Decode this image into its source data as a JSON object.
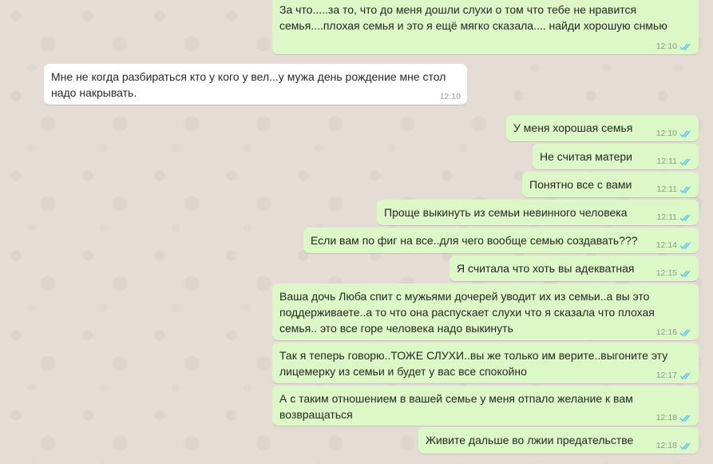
{
  "colors": {
    "background": "#e5ddd5",
    "outgoing_bubble": "#dcf8c6",
    "incoming_bubble": "#ffffff",
    "read_ticks": "#4fc3f7"
  },
  "messages": [
    {
      "dir": "out",
      "text": "За что.....за то, что до меня дошли слухи о том что тебе не нравится семья....плохая семья и это я ещё мягко сказала.... найди хорошую снмью",
      "time": "12:10",
      "status": "read-double-check-icon"
    },
    {
      "dir": "in",
      "text": "Мне не когда разбираться кто у кого у вел...у мужа день рождение мне стол надо накрывать.",
      "time": "12:10"
    },
    {
      "dir": "out",
      "text": "У меня хорошая семья",
      "time": "12:10",
      "status": "read-double-check-icon"
    },
    {
      "dir": "out",
      "text": "Не считая матери",
      "time": "12:11",
      "status": "read-double-check-icon"
    },
    {
      "dir": "out",
      "text": "Понятно все с вами",
      "time": "12:11",
      "status": "read-double-check-icon"
    },
    {
      "dir": "out",
      "text": "Проще выкинуть из семьи невинного человека",
      "time": "12:11",
      "status": "read-double-check-icon"
    },
    {
      "dir": "out",
      "text": "Если вам по фиг на все..для чего вообще семью создавать???",
      "time": "12:14",
      "status": "read-double-check-icon"
    },
    {
      "dir": "out",
      "text": "Я считала что хоть вы адекватная",
      "time": "12:15",
      "status": "read-double-check-icon"
    },
    {
      "dir": "out",
      "text": "Ваша дочь Люба спит с мужьями дочерей уводит их из семьи..а вы это поддерживаете..а то что она  распускает слухи что я сказала что плохая семья.. это все горе человека надо выкинуть",
      "time": "12:16",
      "status": "read-double-check-icon"
    },
    {
      "dir": "out",
      "text": "Так я теперь говорю..ТОЖЕ СЛУХИ..вы же только им верите..выгоните эту лицемерку из семьи и будет у вас все спокойно",
      "time": "12:17",
      "status": "read-double-check-icon"
    },
    {
      "dir": "out",
      "text": "А с таким отношением в вашей семье у меня отпало желание к вам возвращаться",
      "time": "12:18",
      "status": "read-double-check-icon"
    },
    {
      "dir": "out",
      "text": "Живите дальше во лжии предательстве",
      "time": "12:18",
      "status": "read-double-check-icon"
    }
  ]
}
